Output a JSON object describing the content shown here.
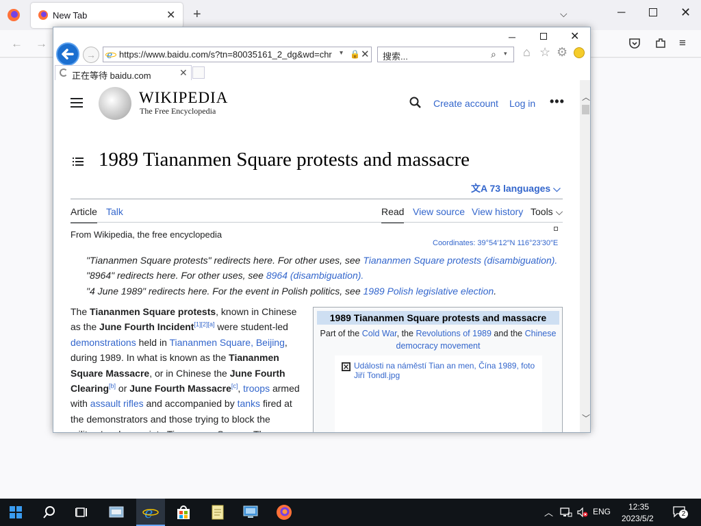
{
  "firefox": {
    "tab_title": "New Tab",
    "new_tab_glyph": "+",
    "list_glyph": "⌵",
    "min_glyph": "─",
    "close_glyph": "✕",
    "back_glyph": "←",
    "fwd_glyph": "→",
    "menu_glyph": "≡",
    "tab_close_glyph": "✕"
  },
  "ie": {
    "url": "https://www.baidu.com/s?tn=80035161_2_dg&wd=chr",
    "search_placeholder": "搜索...",
    "tab_title": "正在等待 baidu.com",
    "min_glyph": "─",
    "close_glyph": "✕",
    "fwd_glyph": "→",
    "stop_glyph": "✕",
    "drop_glyph": "▾",
    "lock_glyph": "🔒",
    "search_icon_glyph": "⌕",
    "home_glyph": "⌂",
    "star_glyph": "☆",
    "gear_glyph": "⚙",
    "tab_close_glyph": "✕",
    "scroll_up": "︿",
    "scroll_down": "﹀"
  },
  "wiki": {
    "wordmark": "WIKIPEDIA",
    "tagline": "The Free Encyclopedia",
    "create_account": "Create account",
    "log_in": "Log in",
    "more": "•••",
    "title": "1989 Tiananmen Square protests and massacre",
    "languages": "73 languages",
    "lang_icon": "文A",
    "tabs": {
      "article": "Article",
      "talk": "Talk",
      "read": "Read",
      "view_source": "View source",
      "view_history": "View history",
      "tools": "Tools"
    },
    "from": "From Wikipedia, the free encyclopedia",
    "coordinates": "Coordinates: 39°54′12″N 116°23′30″E",
    "hatnotes": [
      {
        "text": "\"Tiananmen Square protests\" redirects here. For other uses, see ",
        "link": "Tiananmen Square protests (disambiguation)",
        "end": "."
      },
      {
        "text": "\"8964\" redirects here. For other uses, see ",
        "link": "8964 (disambiguation)",
        "end": "."
      },
      {
        "text": "\"4 June 1989\" redirects here. For the event in Polish politics, see ",
        "link": "1989 Polish legislative election",
        "end": "."
      }
    ],
    "body": {
      "t1": "The ",
      "b1": "Tiananmen Square protests",
      "t2": ", known in Chinese as the ",
      "b2": "June Fourth Incident",
      "ref1": "[1][2][a]",
      "t3": " were student-led ",
      "l1": "demonstrations",
      "t4": " held in ",
      "l2": "Tiananmen Square",
      "t5": ", ",
      "l3": "Beijing",
      "t6": ", during 1989. In what is known as the ",
      "b3": "Tiananmen Square Massacre",
      "t7": ", or in Chinese the ",
      "b4": "June Fourth Clearing",
      "ref2": "[b]",
      "t8": " or ",
      "b5": "June Fourth Massacre",
      "ref3": "[c]",
      "t9": ", ",
      "l4": "troops",
      "t10": " armed with ",
      "l5": "assault rifles",
      "t11": " and accompanied by ",
      "l6": "tanks",
      "t12": " fired at the demonstrators and those trying to block the military's advance into Tiananmen Square. The"
    },
    "infobox": {
      "title": "1989 Tiananmen Square protests and massacre",
      "part_of": "Part of the ",
      "l_cold_war": "Cold War",
      "the": ", the ",
      "l_revolutions": "Revolutions of 1989",
      "and_the": " and the ",
      "l_democracy": "Chinese democracy movement",
      "image_caption": "Události na náměstí Tian an men, Čína 1989, foto Jiří Tondl.jpg"
    }
  },
  "taskbar": {
    "language": "ENG",
    "time": "12:35",
    "date": "2023/5/2",
    "notifications": "2"
  }
}
